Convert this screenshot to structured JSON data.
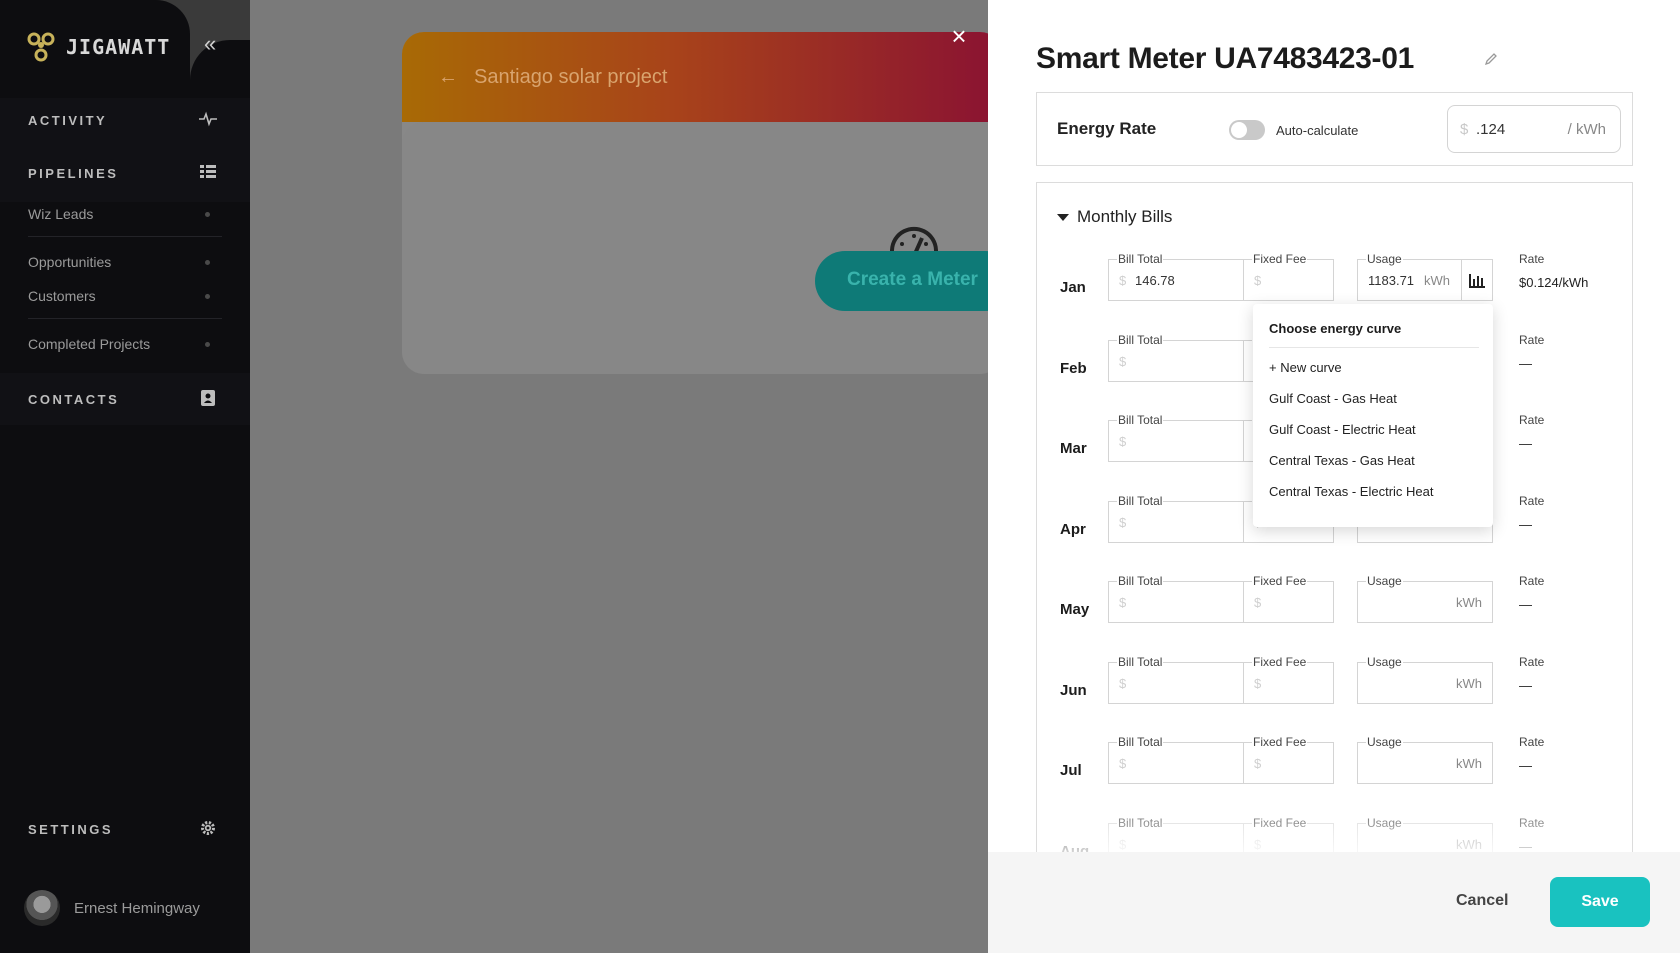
{
  "app": {
    "brand": "JIGAWATT"
  },
  "sidebar": {
    "activity": "ACTIVITY",
    "pipelines": "PIPELINES",
    "pipeline_items": [
      "Wiz Leads",
      "Opportunities",
      "Customers",
      "Completed Projects"
    ],
    "contacts": "CONTACTS",
    "settings": "SETTINGS",
    "user_name": "Ernest Hemingway"
  },
  "background": {
    "project_title": "Santiago solar project",
    "create_meter": "Create a Meter"
  },
  "drawer": {
    "title": "Smart Meter UA7483423-01",
    "energy_rate": {
      "label": "Energy Rate",
      "toggle_label": "Auto-calculate",
      "toggle_on": false,
      "currency": "$",
      "value": ".124",
      "unit": "/ kWh"
    },
    "monthly_bills": {
      "title": "Monthly Bills",
      "labels": {
        "bill_total": "Bill Total",
        "fixed_fee": "Fixed Fee",
        "usage": "Usage",
        "rate": "Rate",
        "currency": "$",
        "kwh": "kWh"
      },
      "rows": [
        {
          "month": "Jan",
          "bill_total": "146.78",
          "fixed_fee": "",
          "usage": "1183.71",
          "rate": "$0.124/kWh"
        },
        {
          "month": "Feb",
          "bill_total": "",
          "fixed_fee": "",
          "usage": "",
          "rate": "—"
        },
        {
          "month": "Mar",
          "bill_total": "",
          "fixed_fee": "",
          "usage": "",
          "rate": "—"
        },
        {
          "month": "Apr",
          "bill_total": "",
          "fixed_fee": "",
          "usage": "",
          "rate": "—"
        },
        {
          "month": "May",
          "bill_total": "",
          "fixed_fee": "",
          "usage": "",
          "rate": "—"
        },
        {
          "month": "Jun",
          "bill_total": "",
          "fixed_fee": "",
          "usage": "",
          "rate": "—"
        },
        {
          "month": "Jul",
          "bill_total": "",
          "fixed_fee": "",
          "usage": "",
          "rate": "—"
        },
        {
          "month": "Aug",
          "bill_total": "",
          "fixed_fee": "",
          "usage": "",
          "rate": "—"
        }
      ]
    },
    "energy_curve_menu": {
      "title": "Choose energy curve",
      "items": [
        "+ New curve",
        "Gulf Coast - Gas Heat",
        "Gulf Coast - Electric Heat",
        "Central Texas - Gas Heat",
        "Central Texas - Electric Heat"
      ]
    },
    "footer": {
      "cancel": "Cancel",
      "save": "Save"
    }
  },
  "colors": {
    "accent": "#19c2c0",
    "sidebar_bg": "#0d0d10"
  }
}
